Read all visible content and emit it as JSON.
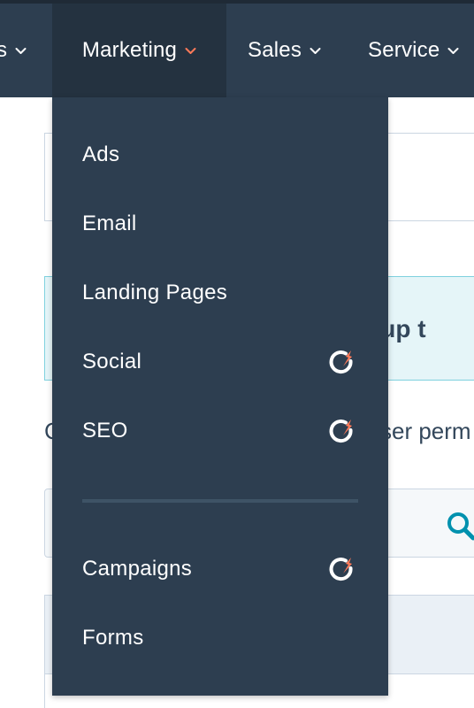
{
  "nav": {
    "items": [
      {
        "label": "s",
        "chevron_color": "#ffffff",
        "active": false
      },
      {
        "label": "Marketing",
        "chevron_color": "#ff7a59",
        "active": true
      },
      {
        "label": "Sales",
        "chevron_color": "#ffffff",
        "active": false
      },
      {
        "label": "Service",
        "chevron_color": "#ffffff",
        "active": false
      }
    ]
  },
  "background": {
    "banner_text": "set up t",
    "body_text_left": "C",
    "body_text_right": "ser perm"
  },
  "dropdown": {
    "items": [
      {
        "label": "Ads",
        "badge": null
      },
      {
        "label": "Email",
        "badge": null
      },
      {
        "label": "Landing Pages",
        "badge": null
      },
      {
        "label": "Social",
        "badge": "upgrade-rocket-icon"
      },
      {
        "label": "SEO",
        "badge": "upgrade-rocket-icon"
      },
      {
        "label": "Campaigns",
        "badge": "upgrade-rocket-icon"
      },
      {
        "label": "Forms",
        "badge": null
      }
    ]
  },
  "colors": {
    "nav_bg": "#2d3e50",
    "dropdown_bg": "#2d3e50",
    "accent": "#ff7a59",
    "search_icon": "#0091ae",
    "banner_border": "#7fd1de"
  }
}
